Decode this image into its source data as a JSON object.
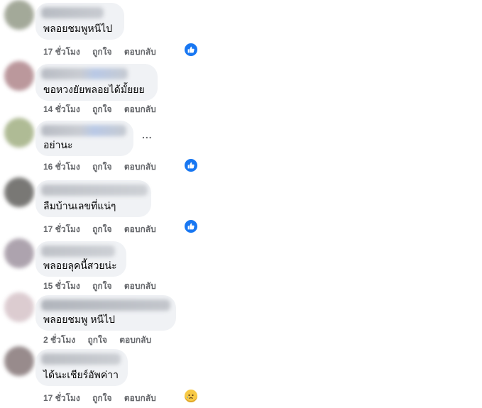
{
  "comments": [
    {
      "text": "พลอยชมพูหนีไป",
      "time": "17 ชั่วโมง",
      "like": "ถูกใจ",
      "reply": "ตอบกลับ",
      "reaction": "like-icon",
      "avatar_color": "#9aa08f"
    },
    {
      "text": "ขอหวงยัยพลอยได้มั้ยยย",
      "time": "14 ชั่วโมง",
      "like": "ถูกใจ",
      "reply": "ตอบกลับ",
      "reaction": "",
      "avatar_color": "#b48d92"
    },
    {
      "text": "อย่านะ",
      "time": "16 ชั่วโมง",
      "like": "ถูกใจ",
      "reply": "ตอบกลับ",
      "reaction": "like-icon",
      "avatar_color": "#a7b48a"
    },
    {
      "text": "ลืมบ้านเลขที่แน่ๆ",
      "time": "17 ชั่วโมง",
      "like": "ถูกใจ",
      "reply": "ตอบกลับ",
      "reaction": "like-icon",
      "avatar_color": "#6b6a67"
    },
    {
      "text": "พลอยลุคนี้สวยน่ะ",
      "time": "15 ชั่วโมง",
      "like": "ถูกใจ",
      "reply": "ตอบกลับ",
      "reaction": "",
      "avatar_color": "#a59aa6"
    },
    {
      "text": "พลอยชมพู หนีไป",
      "time": "2 ชั่วโมง",
      "like": "ถูกใจ",
      "reply": "ตอบกลับ",
      "reaction": "",
      "avatar_color": "#d9c7cc"
    },
    {
      "text": "ได้นะเชียร์อัพค่าา",
      "time": "17 ชั่วโมง",
      "like": "ถูกใจ",
      "reply": "ตอบกลับ",
      "reaction": "sad-face-icon",
      "avatar_color": "#8d7f80"
    }
  ],
  "more_options": "..."
}
